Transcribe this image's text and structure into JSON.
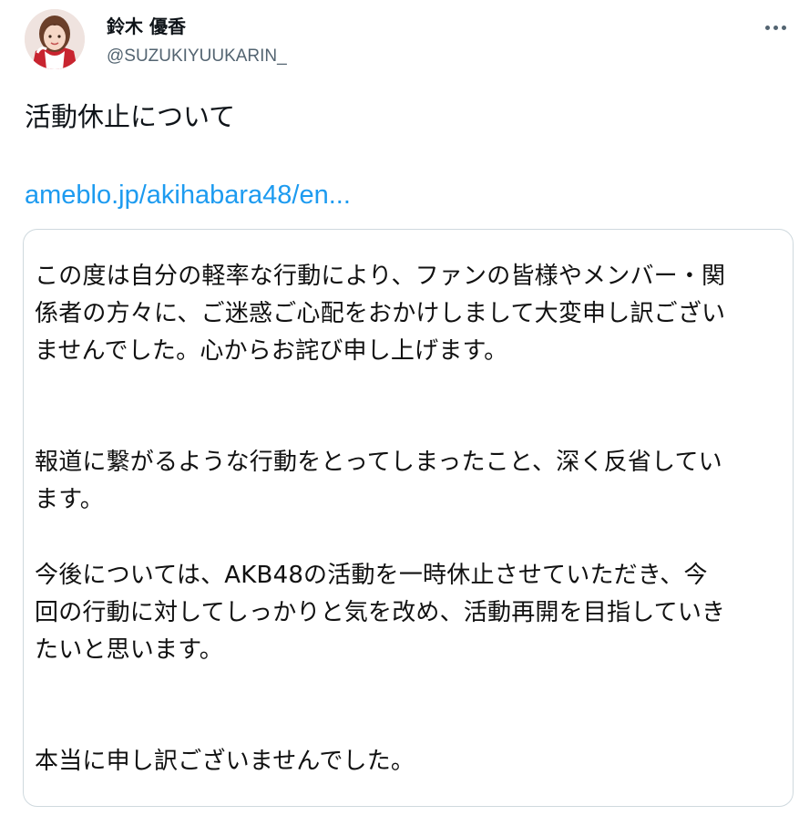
{
  "tweet": {
    "author": {
      "display_name": "鈴木 優香",
      "handle": "@SUZUKIYUUKARIN_",
      "avatar_icon": "profile-photo"
    },
    "more_icon": "more-horizontal-icon",
    "text": "活動休止について",
    "link": {
      "label": "ameblo.jp/akihabara48/en...",
      "color": "#1d9bf0"
    },
    "card": {
      "paragraphs": [
        {
          "lines": [
            "この度は自分の軽率な行動により、ファンの皆様やメンバー・関",
            "係者の方々に、ご迷惑ご心配をおかけしまして大変申し訳ござい",
            "ませんでした。心からお詫び申し上げます。"
          ]
        },
        {
          "lines": [
            "報道に繋がるような行動をとってしまったこと、深く反省してい",
            "ます。"
          ]
        },
        {
          "lines": [
            "今後については、AKB48の活動を一時休止させていただき、今",
            "回の行動に対してしっかりと気を改め、活動再開を目指していき",
            "たいと思います。"
          ]
        },
        {
          "lines": [
            "本当に申し訳ございませんでした。"
          ]
        }
      ]
    }
  },
  "colors": {
    "text_primary": "#0f1419",
    "text_secondary": "#536471",
    "card_border": "#cfd9de"
  }
}
